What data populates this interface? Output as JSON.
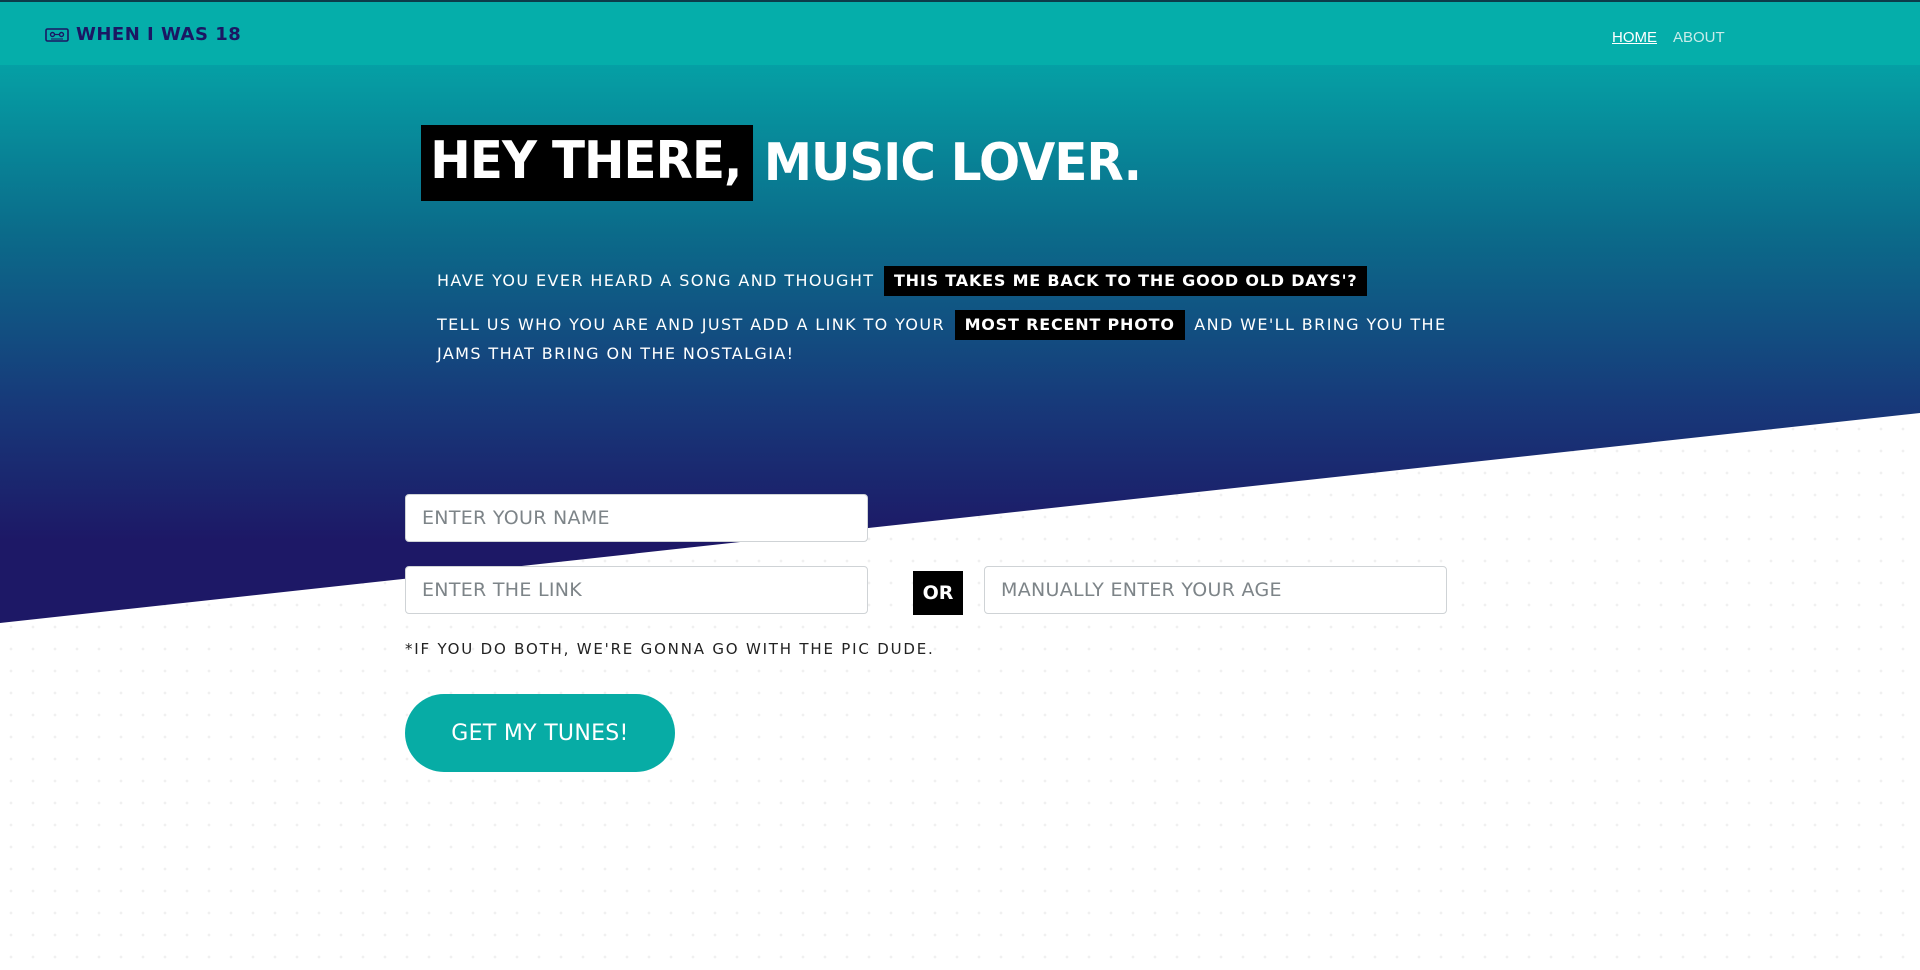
{
  "brand": {
    "icon": "cassette-icon",
    "title": "WHEN I WAS 18",
    "color": "#1b1763"
  },
  "nav": {
    "home": "HOME",
    "about": "ABOUT"
  },
  "hero": {
    "headline_boxed": "HEY THERE,",
    "headline_rest": "MUSIC LOVER.",
    "line1_text": "HAVE YOU EVER HEARD A SONG AND THOUGHT",
    "line1_tag": "THIS TAKES ME BACK TO THE GOOD OLD DAYS'?",
    "line2_text_a": "TELL US WHO YOU ARE AND JUST ADD A LINK TO YOUR",
    "line2_tag": "MOST RECENT PHOTO",
    "line2_text_b": "AND WE'LL BRING YOU THE JAMS THAT BRING ON THE NOSTALGIA!"
  },
  "form": {
    "name_placeholder": "ENTER YOUR NAME",
    "link_placeholder": "ENTER THE LINK",
    "or_label": "OR",
    "age_placeholder": "MANUALLY ENTER YOUR AGE",
    "note": "*IF YOU DO BOTH, WE'RE GONNA GO WITH THE PIC DUDE.",
    "submit_label": "GET MY TUNES!"
  },
  "colors": {
    "navbar": "#05aeaa",
    "accent": "#07aca5",
    "hero_dark": "#1d1866"
  }
}
